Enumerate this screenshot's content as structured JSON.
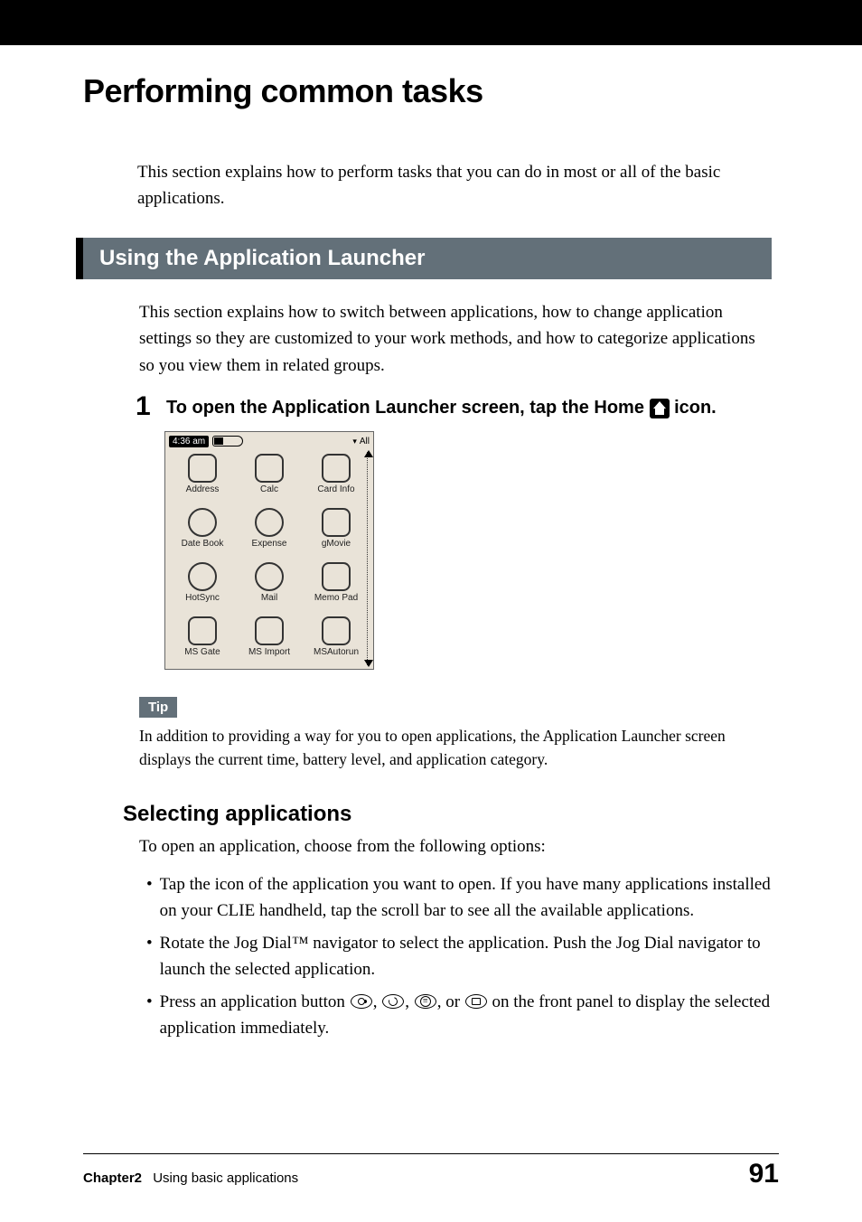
{
  "title": "Performing common tasks",
  "intro": "This section explains how to perform tasks that you can do in most or all of the basic applications.",
  "section_banner": "Using the Application Launcher",
  "section_intro": "This section explains how to switch between applications, how to change application settings so they are customized to your work methods, and how to categorize applications so you view them in related groups.",
  "step": {
    "number": "1",
    "text_before": "To open the Application Launcher screen, tap the Home ",
    "text_after": " icon."
  },
  "screenshot": {
    "time": "4:36 am",
    "category": "All",
    "apps": [
      {
        "label": "Address"
      },
      {
        "label": "Calc"
      },
      {
        "label": "Card Info"
      },
      {
        "label": "Date Book"
      },
      {
        "label": "Expense"
      },
      {
        "label": "gMovie"
      },
      {
        "label": "HotSync"
      },
      {
        "label": "Mail"
      },
      {
        "label": "Memo Pad"
      },
      {
        "label": "MS Gate"
      },
      {
        "label": "MS Import"
      },
      {
        "label": "MSAutorun"
      }
    ]
  },
  "tip": {
    "label": "Tip",
    "text": "In addition to providing a way for you to open applications, the Application Launcher screen displays the current time, battery level, and application category."
  },
  "subheading": "Selecting applications",
  "sub_intro": "To open an application, choose from the following options:",
  "bullets": [
    "Tap the icon of the application you want to open. If you have many applications installed on your CLIE handheld, tap the scroll bar to see all the available applications.",
    "Rotate the Jog Dial™ navigator to select the application. Push the Jog Dial navigator to launch the selected application.",
    {
      "pre": "Press an application button ",
      "mid": ", or ",
      "post": " on the front panel to display the selected application immediately."
    }
  ],
  "footer": {
    "chapter": "Chapter2",
    "chapter_title": "Using basic applications",
    "page": "91"
  }
}
